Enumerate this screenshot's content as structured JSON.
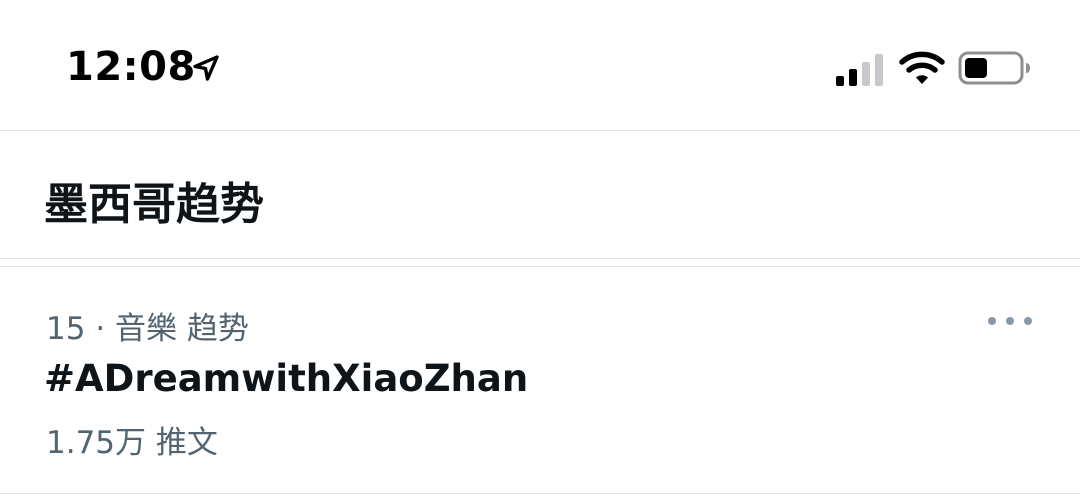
{
  "status_bar": {
    "time": "12:08",
    "icons": [
      "location-arrow-icon",
      "signal-icon",
      "wifi-icon",
      "battery-icon"
    ]
  },
  "header": {
    "title": "墨西哥趋势"
  },
  "trends": [
    {
      "rank": "15",
      "separator": "·",
      "category": "音樂 趋势",
      "name": "#ADreamwithXiaoZhan",
      "count": "1.75万 推文",
      "more_icon": "more-dots-icon"
    }
  ],
  "colors": {
    "text_primary": "#0f1419",
    "text_secondary": "#536471",
    "divider": "#dcdfe3",
    "dots": "#8b98a5"
  }
}
